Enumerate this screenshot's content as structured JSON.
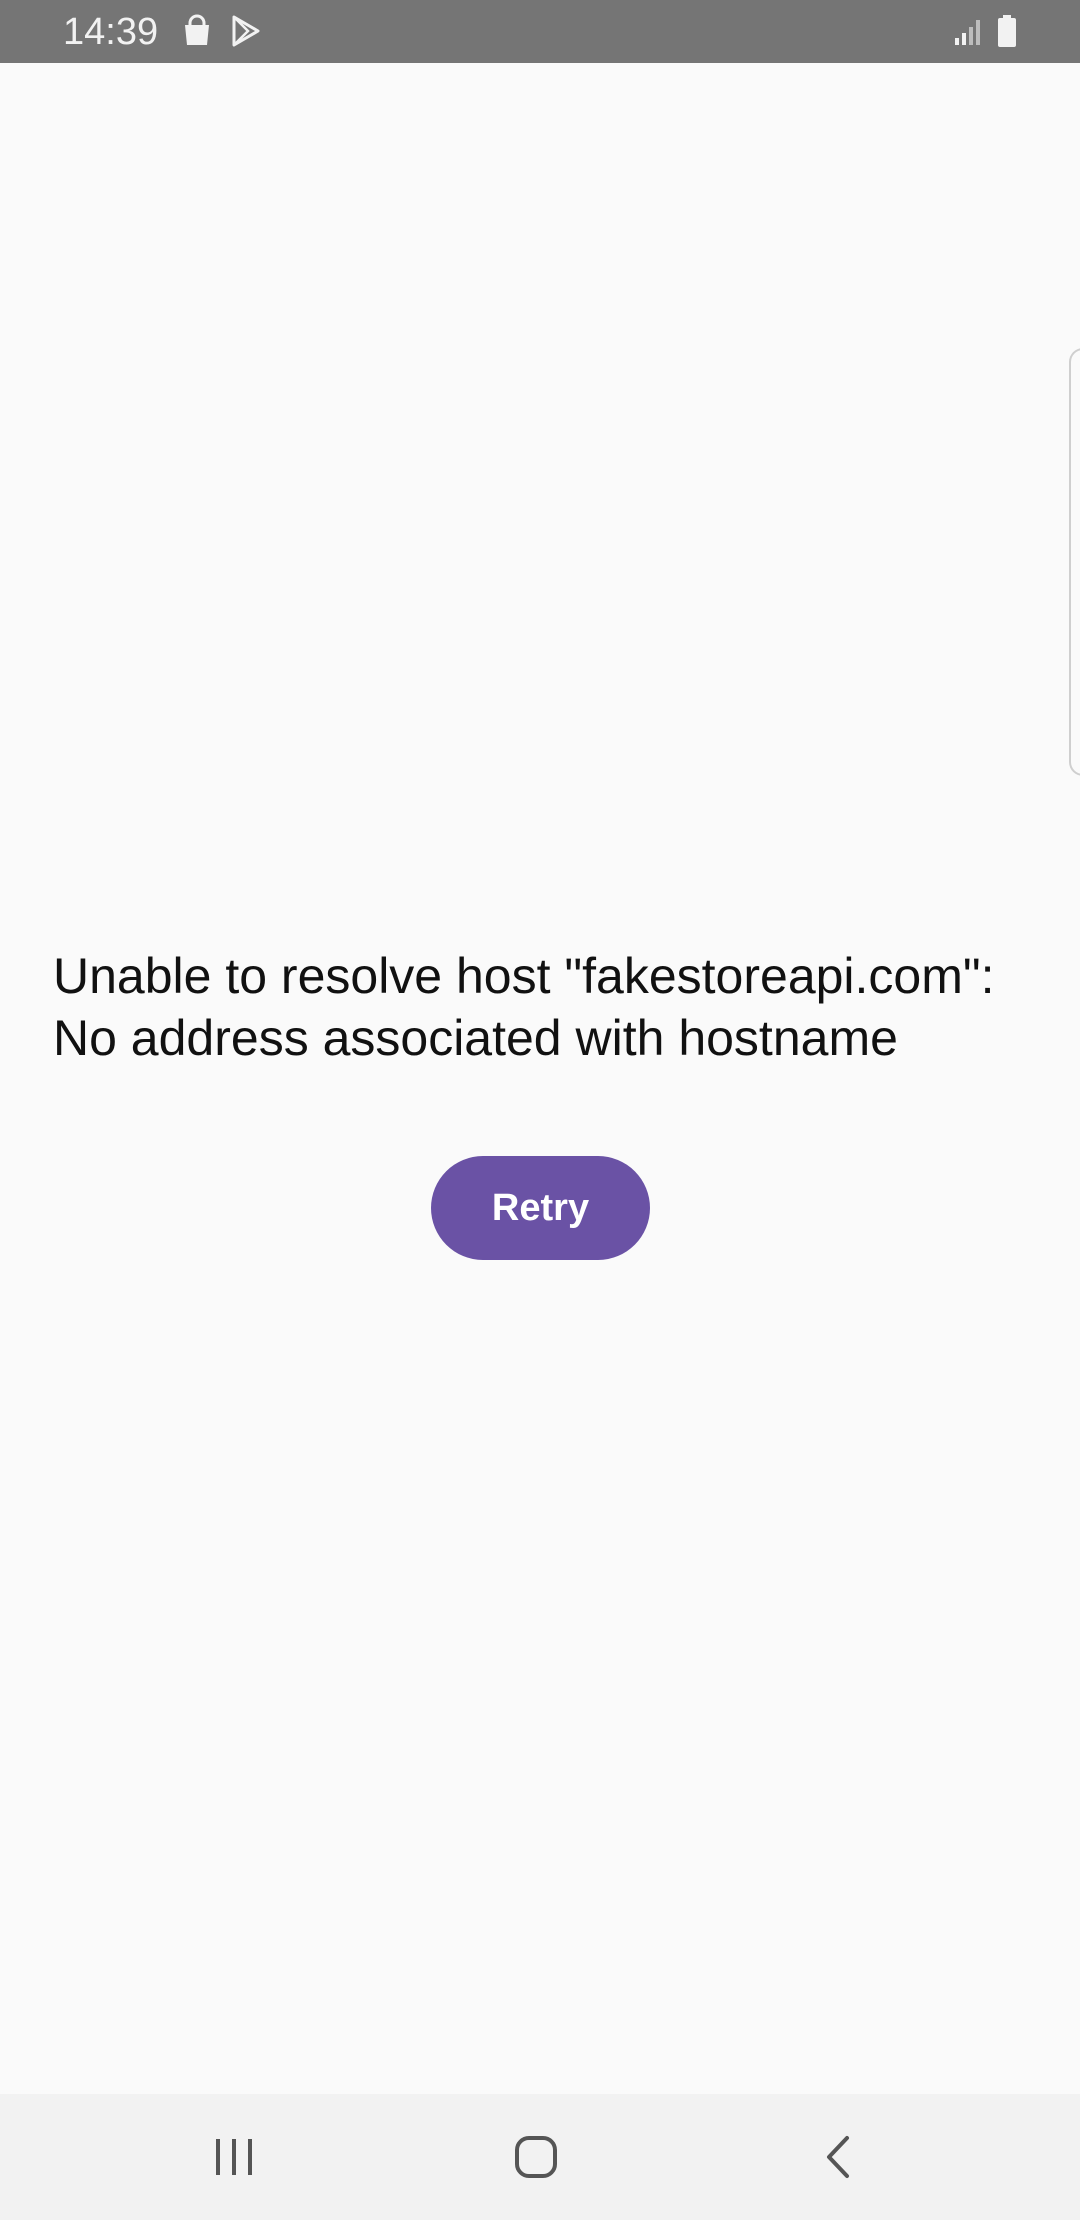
{
  "status_bar": {
    "time": "14:39",
    "left_icons": [
      "shopping-bag-icon",
      "play-store-icon"
    ],
    "right_icons": [
      "signal-icon",
      "battery-icon"
    ],
    "background_color": "#757575"
  },
  "error": {
    "message": "Unable to resolve host \"fakestoreapi.com\":\nNo address associated with hostname"
  },
  "retry_button": {
    "label": "Retry",
    "color": "#6a52a5"
  },
  "nav_bar": {
    "buttons": [
      "recent-apps-icon",
      "home-icon",
      "back-icon"
    ]
  }
}
